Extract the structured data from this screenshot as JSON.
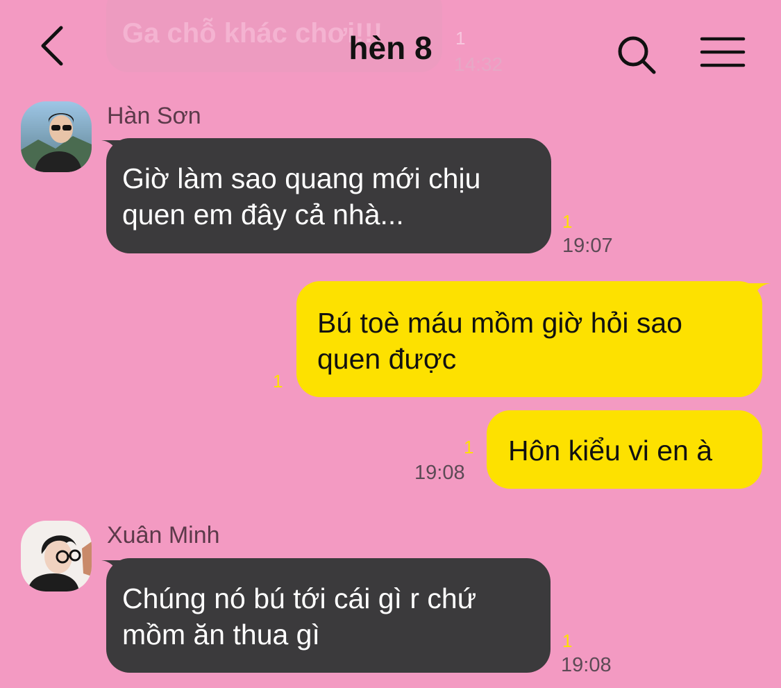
{
  "header": {
    "title": "hèn 8",
    "back_icon": "chevron-left-icon",
    "search_icon": "search-icon",
    "menu_icon": "hamburger-menu-icon"
  },
  "previous_message": {
    "text": "Ga chỗ khác chơi!!!",
    "read_count": "1",
    "time": "14:32"
  },
  "messages": [
    {
      "sender": "Hàn Sơn",
      "side": "left",
      "lines": [
        "Giờ làm sao quang mới chịu",
        "quen em đây cả nhà..."
      ],
      "read_count": "1",
      "time": "19:07"
    },
    {
      "sender": "",
      "side": "right",
      "lines": [
        "Bú toè máu mồm giờ hỏi sao",
        "quen được"
      ],
      "read_count": "1",
      "time": ""
    },
    {
      "sender": "",
      "side": "right",
      "lines": [
        "Hôn kiểu vi en à"
      ],
      "read_count": "1",
      "time": "19:08"
    },
    {
      "sender": "Xuân Minh",
      "side": "left",
      "lines": [
        "Chúng nó bú tới cái gì r chứ",
        "mồm ăn thua gì"
      ],
      "read_count": "1",
      "time": "19:08"
    }
  ],
  "colors": {
    "background": "#f39ac2",
    "incoming_bubble": "#3b3a3c",
    "outgoing_bubble": "#fde100",
    "read_indicator": "#fde100"
  }
}
